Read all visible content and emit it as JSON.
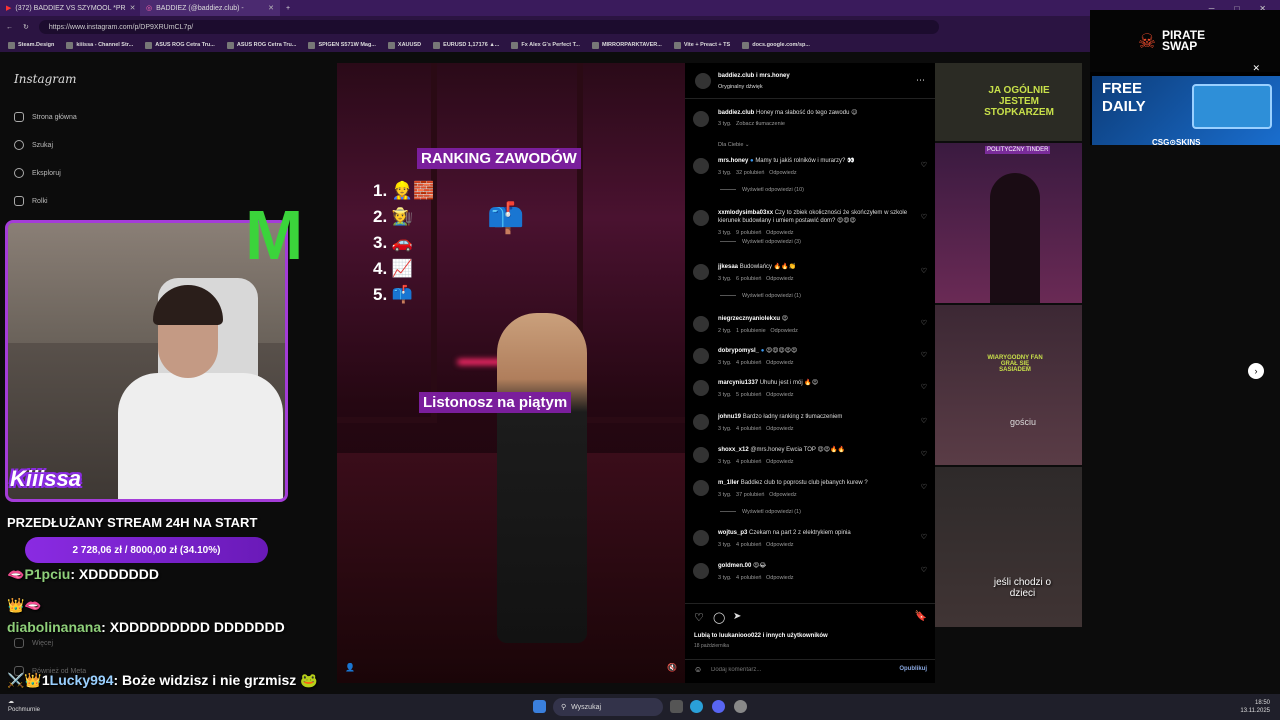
{
  "browser": {
    "tabs": [
      {
        "label": "(372) BADDIEZ VS SZYMOOL *PR",
        "active": false
      },
      {
        "label": "BADDIEZ (@baddiez.club) -",
        "active": true
      }
    ],
    "url": "https://www.instagram.com/p/DP9XRUmCL7p/",
    "bookmarks": [
      "Steam.Design",
      "kiiissa - Channel Str...",
      "ASUS ROG Cetra Tru...",
      "ASUS ROG Cetra Tru...",
      "SPIGEN S571W Mag...",
      "XAUUSD",
      "EURUSD 1,17176 ▲...",
      "Fx Alex G's Perfect T...",
      "MIRRORPARKTAVER...",
      "Vite + Preact + TS",
      "docs.google.com/sp..."
    ]
  },
  "instagram": {
    "logo": "Instagram",
    "nav": [
      "Strona główna",
      "Szukaj",
      "Eksploruj",
      "Rolki"
    ],
    "nav_bottom": [
      "Więcej",
      "Również od Meta"
    ],
    "video": {
      "ranking_title": "RANKING ZAWODÓW",
      "ranking_items": [
        "1. 👷🧱",
        "2. 🧑‍🌾",
        "3. 🚗",
        "4. 📈",
        "5. 📫"
      ],
      "mailbox_emoji": "📫",
      "caption": "Listonosz na piątym"
    },
    "post": {
      "author": "baddiez.club i mrs.honey",
      "audio": "Oryginalny dźwięk",
      "caption_user": "baddiez.club",
      "caption_text": "Honey ma słabość do tego zawodu 😉",
      "caption_time": "3 tyg.",
      "caption_translate": "Zobacz tłumaczenie",
      "for_you": "Dla Ciebie ⌄",
      "comments": [
        {
          "user": "mrs.honey",
          "verified": true,
          "text": "Mamy tu jakiś rolników i murarzy? 👀",
          "time": "3 tyg.",
          "likes": "32 polubień",
          "reply": "Odpowiedz",
          "replies": "Wyświetl odpowiedzi (10)"
        },
        {
          "user": "xxmlodysimba03xx",
          "verified": false,
          "text": "Czy to zbiek okoliczności że skończyłem w szkole kierunek budowlany i umiem postawić dom? 😍😍😍",
          "time": "3 tyg.",
          "likes": "9 polubień",
          "reply": "Odpowiedz",
          "replies": "Wyświetl odpowiedzi (3)"
        },
        {
          "user": "jjkesaa",
          "verified": false,
          "text": "Budowlańcy 🔥🔥👏",
          "time": "3 tyg.",
          "likes": "6 polubień",
          "reply": "Odpowiedz",
          "replies": "Wyświetl odpowiedzi (1)"
        },
        {
          "user": "niegrzecznyaniolekxu",
          "verified": false,
          "text": "😍",
          "time": "2 tyg.",
          "likes": "1 polubienie",
          "reply": "Odpowiedz",
          "replies": ""
        },
        {
          "user": "dobrypomysl_",
          "verified": true,
          "text": "😍😍😍😍😍",
          "time": "3 tyg.",
          "likes": "4 polubień",
          "reply": "Odpowiedz",
          "replies": ""
        },
        {
          "user": "marcyniu1337",
          "verified": false,
          "text": "Uhuhu jest i mój 🔥😍",
          "time": "3 tyg.",
          "likes": "5 polubień",
          "reply": "Odpowiedz",
          "replies": ""
        },
        {
          "user": "johnu19",
          "verified": false,
          "text": "Bardzo ładny ranking z tłumaczeniem",
          "time": "3 tyg.",
          "likes": "4 polubień",
          "reply": "Odpowiedz",
          "replies": ""
        },
        {
          "user": "shoxx_x12",
          "verified": false,
          "text": "@mrs.honey Ewcia TOP 😍😍🔥🔥",
          "time": "3 tyg.",
          "likes": "4 polubień",
          "reply": "Odpowiedz",
          "replies": ""
        },
        {
          "user": "m_1ller",
          "verified": false,
          "text": "Baddiez club to poprostu club jebanych kurew ?",
          "time": "3 tyg.",
          "likes": "37 polubień",
          "reply": "Odpowiedz",
          "replies": "Wyświetl odpowiedzi (1)"
        },
        {
          "user": "wojtus_p3",
          "verified": false,
          "text": "Czekam na part 2 z elektrykiem opinia",
          "time": "3 tyg.",
          "likes": "4 polubień",
          "reply": "Odpowiedz",
          "replies": ""
        },
        {
          "user": "goldmen.00",
          "verified": false,
          "text": "😍😂",
          "time": "3 tyg.",
          "likes": "4 polubień",
          "reply": "Odpowiedz",
          "replies": ""
        }
      ],
      "liked_by": "Lubią to luukaniooo022 i innych użytkowników",
      "date": "18 października",
      "comment_placeholder": "Dodaj komentarz...",
      "publish": "Opublikuj"
    },
    "grid_labels": [
      "JA OGÓLNIE JESTEM STOPKARZEM",
      "POLITYCZNY TINDER",
      "WIARYGODNY FAN GRAŁ SIĘ SASIADEM",
      "gościu",
      "jeśli chodzi o dzieci"
    ]
  },
  "stream_overlay": {
    "streamer": "Kiiissa",
    "title": "PRZEDŁUŻANY STREAM 24H NA START",
    "goal": "2 728,06 zł / 8000,00 zł (34.10%)",
    "goal_progress": 0.341,
    "chat": [
      {
        "badges": "🫦",
        "user": "P1pciu",
        "text": "XDDDDDDD"
      },
      {
        "badges": "👑🫦",
        "user": "",
        "text": ""
      },
      {
        "badges": "",
        "user": "diabolinanana",
        "text": "XDDDDDDDDD DDDDDDD"
      },
      {
        "badges": "⚔️👑1",
        "user": "Lucky994",
        "text": "Boże widzisz i nie grzmisz 🐸"
      }
    ]
  },
  "ad": {
    "brand": "PIRATE SWAP",
    "promo": "FREE DAILY",
    "sub": "CSG⊙SKINS"
  },
  "taskbar": {
    "search": "Wyszukaj",
    "weather": "Pochmurnie",
    "time": "18:50",
    "date": "13.11.2025"
  }
}
